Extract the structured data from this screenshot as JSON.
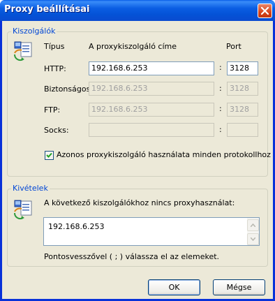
{
  "window": {
    "title": "Proxy beállításai"
  },
  "servers": {
    "legend": "Kiszolgálók",
    "col_type": "Típus",
    "col_address": "A proxykiszolgáló címe",
    "col_port": "Port",
    "rows": [
      {
        "label": "HTTP:",
        "address": "192.168.6.253",
        "port": "3128",
        "enabled": true
      },
      {
        "label": "Biztonságos:",
        "address": "192.168.6.253",
        "port": "3128",
        "enabled": false
      },
      {
        "label": "FTP:",
        "address": "192.168.6.253",
        "port": "3128",
        "enabled": false
      },
      {
        "label": "Socks:",
        "address": "",
        "port": "",
        "enabled": false
      }
    ],
    "colon": ":",
    "same_proxy_label": "Azonos proxykiszolgáló használata minden protokollhoz",
    "same_proxy_checked": true
  },
  "exceptions": {
    "legend": "Kivételek",
    "description": "A következő kiszolgálókhoz nincs proxyhasználat:",
    "value": "192.168.6.253",
    "hint": "Pontosvesszővel ( ; ) válassza el az elemeket."
  },
  "buttons": {
    "ok": "OK",
    "cancel": "Mégse"
  },
  "colors": {
    "title_bar": "#0a5de3",
    "legend_text": "#0046d5",
    "dialog_bg": "#ece9d8"
  }
}
